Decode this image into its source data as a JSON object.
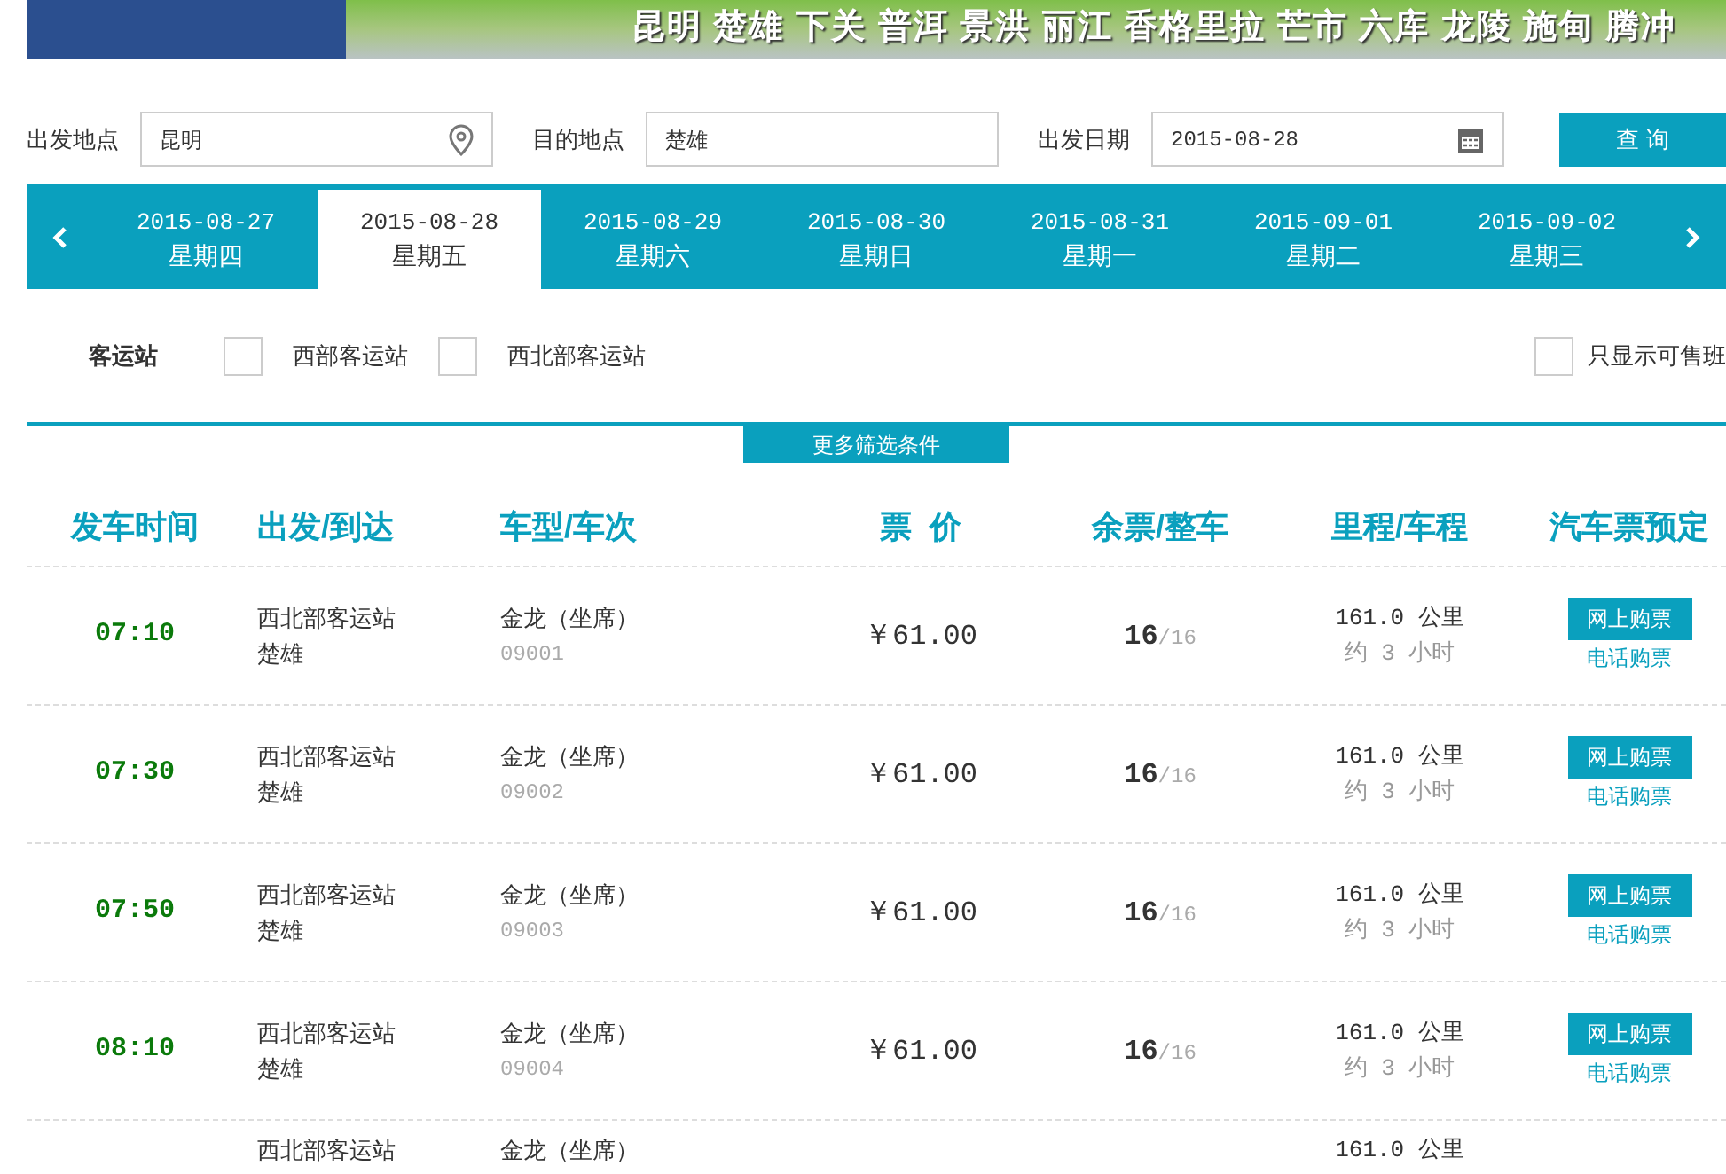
{
  "banner": {
    "cities": "昆明 楚雄 下关 普洱 景洪 丽江 香格里拉 芒市 六库 龙陵 施甸 腾冲"
  },
  "search": {
    "from_label": "出发地点",
    "from_value": "昆明",
    "to_label": "目的地点",
    "to_value": "楚雄",
    "date_label": "出发日期",
    "date_value": "2015-08-28",
    "button": "查 询"
  },
  "dates": [
    {
      "date": "2015-08-27",
      "weekday": "星期四",
      "selected": false
    },
    {
      "date": "2015-08-28",
      "weekday": "星期五",
      "selected": true
    },
    {
      "date": "2015-08-29",
      "weekday": "星期六",
      "selected": false
    },
    {
      "date": "2015-08-30",
      "weekday": "星期日",
      "selected": false
    },
    {
      "date": "2015-08-31",
      "weekday": "星期一",
      "selected": false
    },
    {
      "date": "2015-09-01",
      "weekday": "星期二",
      "selected": false
    },
    {
      "date": "2015-09-02",
      "weekday": "星期三",
      "selected": false
    }
  ],
  "filters": {
    "label": "客运站",
    "stations": [
      {
        "label": "西部客运站",
        "checked": false
      },
      {
        "label": "西北部客运站",
        "checked": false
      }
    ],
    "only_available": {
      "label": "只显示可售班",
      "checked": false
    },
    "more_button": "更多筛选条件"
  },
  "table": {
    "columns": [
      "发车时间",
      "出发/到达",
      "车型/车次",
      "票  价",
      "余票/整车",
      "里程/车程",
      "汽车票预定"
    ],
    "rows": [
      {
        "time": "07:10",
        "origin": "西北部客运站",
        "destination": "楚雄",
        "vehicle": "金龙（坐席）",
        "trip_no": "09001",
        "price": "￥61.00",
        "seats_left": "16",
        "seats_total": "/16",
        "distance": "161.0 公里",
        "duration": "约 3 小时",
        "buy_online": "网上购票",
        "buy_phone": "电话购票"
      },
      {
        "time": "07:30",
        "origin": "西北部客运站",
        "destination": "楚雄",
        "vehicle": "金龙（坐席）",
        "trip_no": "09002",
        "price": "￥61.00",
        "seats_left": "16",
        "seats_total": "/16",
        "distance": "161.0 公里",
        "duration": "约 3 小时",
        "buy_online": "网上购票",
        "buy_phone": "电话购票"
      },
      {
        "time": "07:50",
        "origin": "西北部客运站",
        "destination": "楚雄",
        "vehicle": "金龙（坐席）",
        "trip_no": "09003",
        "price": "￥61.00",
        "seats_left": "16",
        "seats_total": "/16",
        "distance": "161.0 公里",
        "duration": "约 3 小时",
        "buy_online": "网上购票",
        "buy_phone": "电话购票"
      },
      {
        "time": "08:10",
        "origin": "西北部客运站",
        "destination": "楚雄",
        "vehicle": "金龙（坐席）",
        "trip_no": "09004",
        "price": "￥61.00",
        "seats_left": "16",
        "seats_total": "/16",
        "distance": "161.0 公里",
        "duration": "约 3 小时",
        "buy_online": "网上购票",
        "buy_phone": "电话购票"
      },
      {
        "origin": "西北部客运站",
        "vehicle": "金龙（坐席）",
        "distance": "161.0 公里"
      }
    ]
  }
}
